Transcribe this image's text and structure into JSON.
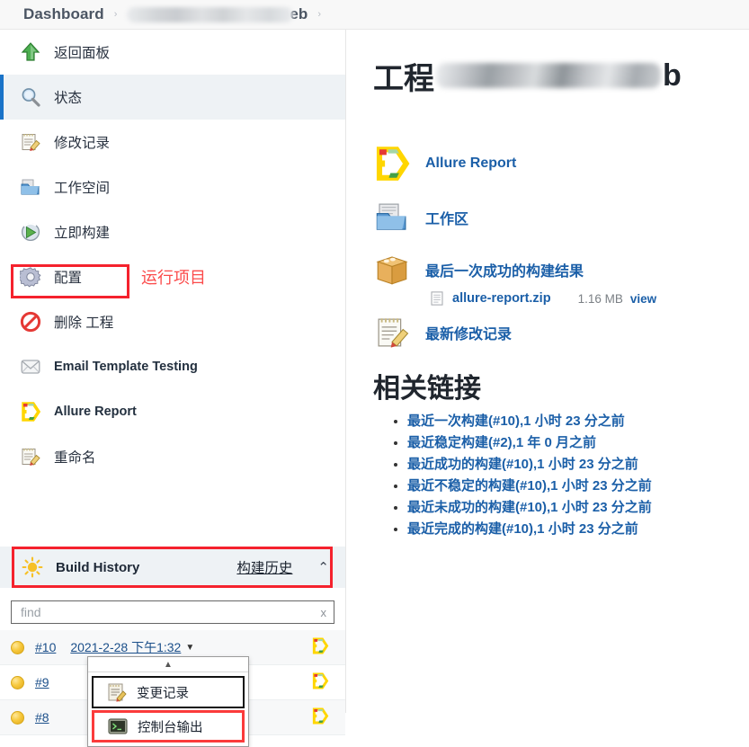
{
  "breadcrumb": {
    "home": "Dashboard",
    "separator": "›",
    "project_suffix": "eb"
  },
  "sidebar": {
    "tasks": [
      {
        "label": "返回面板",
        "icon": "up-arrow-icon",
        "active": false,
        "latin": false
      },
      {
        "label": "状态",
        "icon": "magnifier-icon",
        "active": true,
        "latin": false
      },
      {
        "label": "修改记录",
        "icon": "notepad-pencil-icon",
        "active": false,
        "latin": false
      },
      {
        "label": "工作空间",
        "icon": "folder-icon",
        "active": false,
        "latin": false
      },
      {
        "label": "立即构建",
        "icon": "build-now-icon",
        "active": false,
        "latin": false
      },
      {
        "label": "配置",
        "icon": "gear-icon",
        "active": false,
        "latin": false
      },
      {
        "label": "删除 工程",
        "icon": "delete-icon",
        "active": false,
        "latin": false
      },
      {
        "label": "Email Template Testing",
        "icon": "envelope-icon",
        "active": false,
        "latin": true
      },
      {
        "label": "Allure Report",
        "icon": "allure-icon",
        "active": false,
        "latin": true
      },
      {
        "label": "重命名",
        "icon": "notepad-pencil-icon",
        "active": false,
        "latin": false
      }
    ],
    "annotation_run_project": "运行项目",
    "build_history": {
      "title": "Build History",
      "cn_label": "构建历史",
      "chevron": "⌃",
      "find_placeholder": "find",
      "find_value": "",
      "find_clear": "x"
    },
    "builds": [
      {
        "number": "#10",
        "date": "2021-2-28 下午1:32",
        "caret": "▼",
        "status": "yellow",
        "has_date": true
      },
      {
        "number": "#9",
        "date": "",
        "caret": "",
        "status": "yellow",
        "has_date": false
      },
      {
        "number": "#8",
        "date": "",
        "caret": "",
        "status": "yellow",
        "has_date": false
      }
    ],
    "dropdown": {
      "arrow": "▲",
      "items": [
        {
          "label": "变更记录",
          "icon": "notepad-pencil-icon",
          "highlight": "black"
        },
        {
          "label": "控制台输出",
          "icon": "console-icon",
          "highlight": "red"
        }
      ]
    }
  },
  "content": {
    "project_title_prefix": "工程",
    "project_title_suffix": "b",
    "links": [
      {
        "label": "Allure Report",
        "icon": "allure-icon"
      },
      {
        "label": "工作区",
        "icon": "workspace-icon"
      },
      {
        "label": "最后一次成功的构建结果",
        "icon": "package-icon"
      },
      {
        "label": "最新修改记录",
        "icon": "notepad-pencil-icon"
      }
    ],
    "artifact": {
      "filename": "allure-report.zip",
      "size": "1.16 MB",
      "view": "view",
      "icon": "document-icon"
    },
    "related_title": "相关链接",
    "related_links": [
      "最近一次构建(#10),1 小时 23 分之前",
      "最近稳定构建(#2),1 年 0 月之前",
      "最近成功的构建(#10),1 小时 23 分之前",
      "最近不稳定的构建(#10),1 小时 23 分之前",
      "最近未成功的构建(#10),1 小时 23 分之前",
      "最近完成的构建(#10),1 小时 23 分之前"
    ]
  },
  "colors": {
    "link_blue": "#1b5fa8",
    "annotation_red": "#fb4b4b",
    "active_bar_blue": "#1a73c8",
    "status_yellow": "#f7c93f"
  }
}
